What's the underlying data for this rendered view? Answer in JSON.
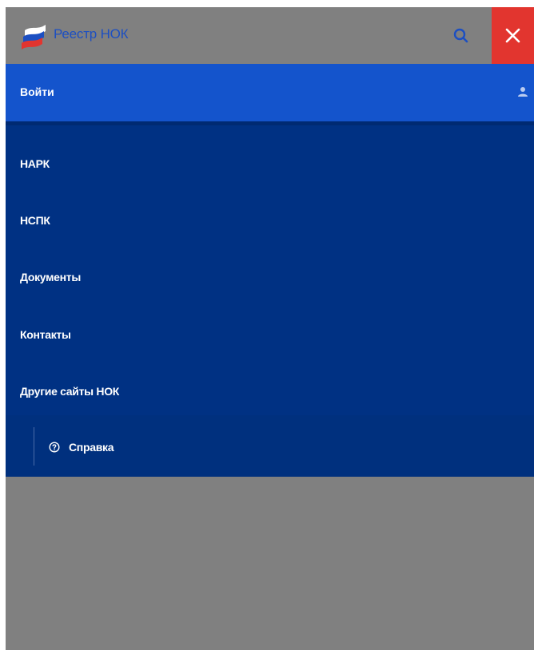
{
  "header": {
    "title": "Реестр НОК",
    "logo_icon": "russian-flag-logo",
    "search_icon": "search-icon",
    "close_icon": "close-icon",
    "title_color": "#1c4fc2",
    "close_bg": "#e2352f"
  },
  "login": {
    "label": "Войти",
    "icon": "user-icon",
    "bg": "#1454cc"
  },
  "menu": {
    "bg": "#003183",
    "items": [
      {
        "label": "НАРК"
      },
      {
        "label": "НСПК"
      },
      {
        "label": "Документы"
      },
      {
        "label": "Контакты"
      },
      {
        "label": "Другие сайты НОК"
      }
    ]
  },
  "footer": {
    "help_label": "Справка",
    "help_icon": "help-circle-icon"
  },
  "overlay_color": "#808080"
}
